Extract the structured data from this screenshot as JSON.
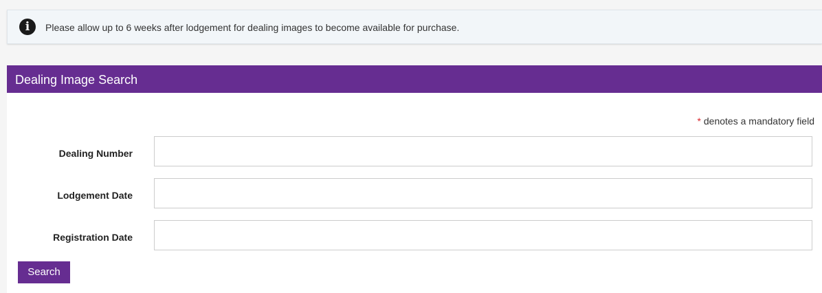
{
  "notice": {
    "icon": "info-icon",
    "icon_glyph": "i",
    "text": "Please allow up to 6 weeks after lodgement for dealing images to become available for purchase."
  },
  "panel": {
    "title": "Dealing Image Search",
    "mandatory_asterisk": "*",
    "mandatory_text": " denotes a mandatory field",
    "fields": [
      {
        "label": "Dealing Number",
        "value": "",
        "placeholder": ""
      },
      {
        "label": "Lodgement Date",
        "value": "",
        "placeholder": ""
      },
      {
        "label": "Registration Date",
        "value": "",
        "placeholder": ""
      }
    ],
    "search_button_label": "Search"
  },
  "colors": {
    "brand_purple": "#662d91",
    "mandatory_red": "#d9262b",
    "notice_background": "#f2f6f9"
  }
}
